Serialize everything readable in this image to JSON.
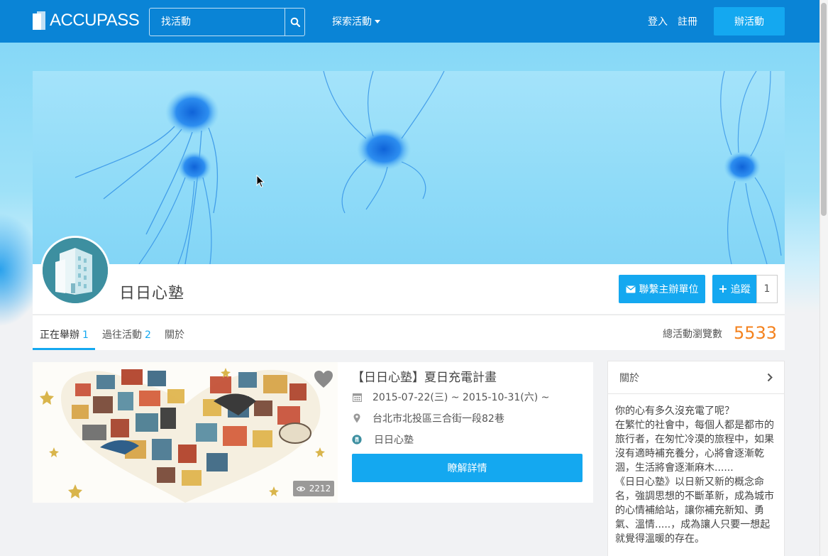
{
  "topnav": {
    "logo_text": "ACCUPASS",
    "search_placeholder": "找活動",
    "explore_label": "探索活動",
    "login_label": "登入",
    "register_label": "註冊",
    "host_event_label": "辦活動"
  },
  "profile": {
    "name": "日日心塾",
    "contact_label": "聯繫主辦單位",
    "follow_label": "追蹤",
    "follow_count": "1"
  },
  "tabs": [
    {
      "label": "正在舉辦",
      "count": "1",
      "active": true
    },
    {
      "label": "過往活動",
      "count": "2",
      "active": false
    },
    {
      "label": "關於",
      "count": "",
      "active": false
    }
  ],
  "stats": {
    "views_label": "總活動瀏覽數",
    "views_count": "5533"
  },
  "event": {
    "title": "【日日心塾】夏日充電計畫",
    "date": "2015-07-22(三) ~ 2015-10-31(六) ~",
    "location": "台北市北投區三合街一段82巷",
    "organizer": "日日心塾",
    "views": "2212",
    "detail_button": "瞭解詳情"
  },
  "about": {
    "title": "關於",
    "body": "你的心有多久沒充電了呢？\n在繁忙的社會中，每個人都是都市的旅行者，在匆忙冷漠的旅程中，如果沒有適時補充養分，心將會逐漸乾涸，生活將會逐漸麻木......\n《日日心塾》以日新又新的概念命名，強調思想的不斷革新，成為城市的心情補給站，讓你補充新知、勇氣、溫情.....，成為讓人只要一想起就覺得溫暖的存在。"
  },
  "colors": {
    "nav_bg": "#0a84d6",
    "accent": "#14a8f0",
    "views_count": "#f4821e"
  }
}
